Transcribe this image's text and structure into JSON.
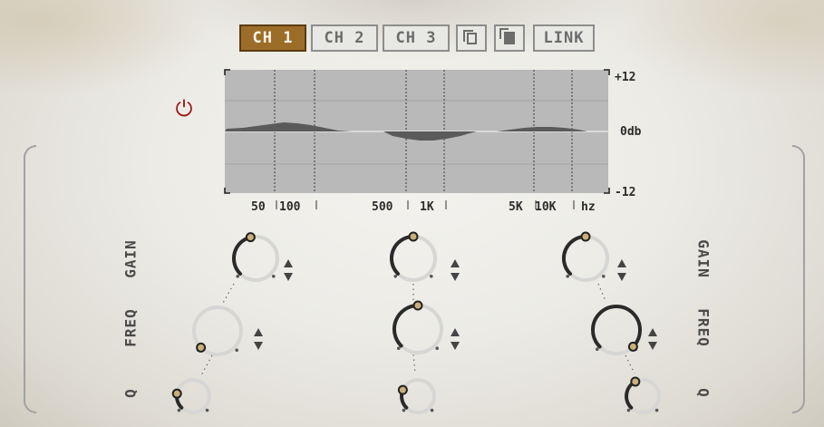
{
  "channels": [
    {
      "label": "CH 1",
      "active": true
    },
    {
      "label": "CH 2",
      "active": false
    },
    {
      "label": "CH 3",
      "active": false
    }
  ],
  "toolbar": {
    "copy_icon": "copy-icon",
    "paste_icon": "paste-icon",
    "link_label": "LINK"
  },
  "power": {
    "icon": "power-icon",
    "color": "#9b1b1b",
    "symbol": "⏻"
  },
  "eq_display": {
    "db_labels": {
      "top": "+12",
      "mid": "0db",
      "bottom": "-12"
    },
    "hz_labels": [
      "50",
      "100",
      "500",
      "1K",
      "5K",
      "10K",
      "hz"
    ]
  },
  "labels": {
    "gain": "GAIN",
    "freq": "FREQ",
    "q": "Q"
  },
  "knobs": {
    "band1": {
      "gain": 0.45,
      "freq": 0.0,
      "q": 0.2
    },
    "band2": {
      "gain": 0.5,
      "freq": 0.5,
      "q": 0.25
    },
    "band3": {
      "gain": 0.5,
      "freq": 1.0,
      "q": 0.4
    }
  },
  "colors": {
    "accent": "#9c6d28",
    "power": "#9b1b1b",
    "display_bg": "#b9b9b9",
    "arc": "#2a2a2a"
  }
}
